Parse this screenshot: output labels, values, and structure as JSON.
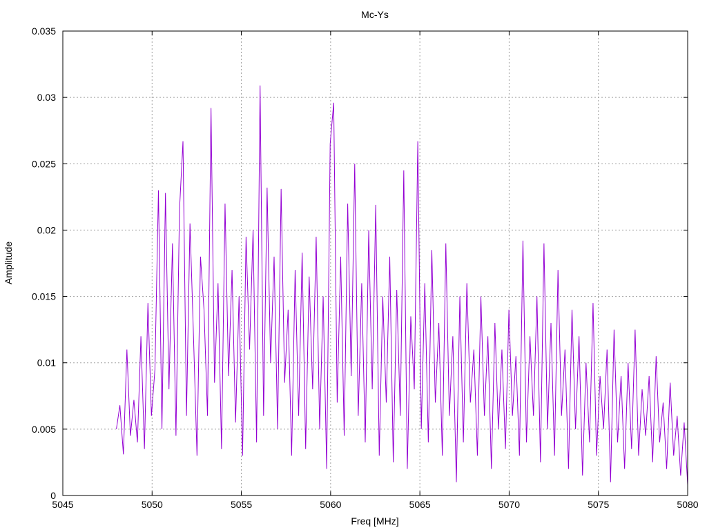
{
  "chart_data": {
    "type": "line",
    "title": "Mc-Ys",
    "xlabel": "Freq [MHz]",
    "ylabel": "Amplitude",
    "xlim": [
      5045,
      5080
    ],
    "ylim": [
      0,
      0.035
    ],
    "grid": true,
    "legend": "none",
    "xticks": [
      "5045",
      "5050",
      "5055",
      "5060",
      "5065",
      "5070",
      "5075",
      "5080"
    ],
    "yticks": [
      "0",
      "0.005",
      "0.01",
      "0.015",
      "0.02",
      "0.025",
      "0.03",
      "0.035"
    ],
    "series": [
      {
        "name": "Mc-Ys",
        "color": "#9400d3",
        "x_start": 5048,
        "x_end": 5080,
        "values": [
          0.005,
          0.0068,
          0.0031,
          0.011,
          0.0045,
          0.0072,
          0.004,
          0.012,
          0.0035,
          0.0145,
          0.006,
          0.0095,
          0.023,
          0.005,
          0.0228,
          0.008,
          0.019,
          0.0045,
          0.0215,
          0.0267,
          0.006,
          0.0205,
          0.012,
          0.003,
          0.018,
          0.014,
          0.006,
          0.0292,
          0.0085,
          0.016,
          0.0035,
          0.022,
          0.009,
          0.017,
          0.0055,
          0.015,
          0.003,
          0.0195,
          0.011,
          0.02,
          0.004,
          0.0309,
          0.006,
          0.0232,
          0.01,
          0.018,
          0.005,
          0.0231,
          0.0085,
          0.014,
          0.003,
          0.017,
          0.006,
          0.0183,
          0.0035,
          0.0165,
          0.008,
          0.0195,
          0.005,
          0.015,
          0.002,
          0.0265,
          0.0296,
          0.007,
          0.018,
          0.0045,
          0.022,
          0.009,
          0.025,
          0.006,
          0.016,
          0.004,
          0.02,
          0.008,
          0.0219,
          0.003,
          0.015,
          0.007,
          0.018,
          0.0025,
          0.0155,
          0.006,
          0.0245,
          0.002,
          0.0135,
          0.008,
          0.0267,
          0.005,
          0.016,
          0.004,
          0.0185,
          0.007,
          0.013,
          0.003,
          0.019,
          0.006,
          0.012,
          0.001,
          0.015,
          0.004,
          0.016,
          0.007,
          0.011,
          0.003,
          0.015,
          0.006,
          0.012,
          0.002,
          0.013,
          0.005,
          0.011,
          0.0035,
          0.014,
          0.006,
          0.0105,
          0.003,
          0.0192,
          0.004,
          0.012,
          0.006,
          0.015,
          0.0025,
          0.019,
          0.005,
          0.013,
          0.003,
          0.017,
          0.006,
          0.011,
          0.002,
          0.014,
          0.005,
          0.012,
          0.0015,
          0.01,
          0.004,
          0.0145,
          0.003,
          0.009,
          0.005,
          0.011,
          0.001,
          0.0125,
          0.004,
          0.009,
          0.002,
          0.01,
          0.0035,
          0.0125,
          0.003,
          0.008,
          0.0045,
          0.009,
          0.0025,
          0.0105,
          0.004,
          0.007,
          0.002,
          0.0085,
          0.003,
          0.006,
          0.0015,
          0.0055,
          0.0008
        ]
      }
    ]
  }
}
